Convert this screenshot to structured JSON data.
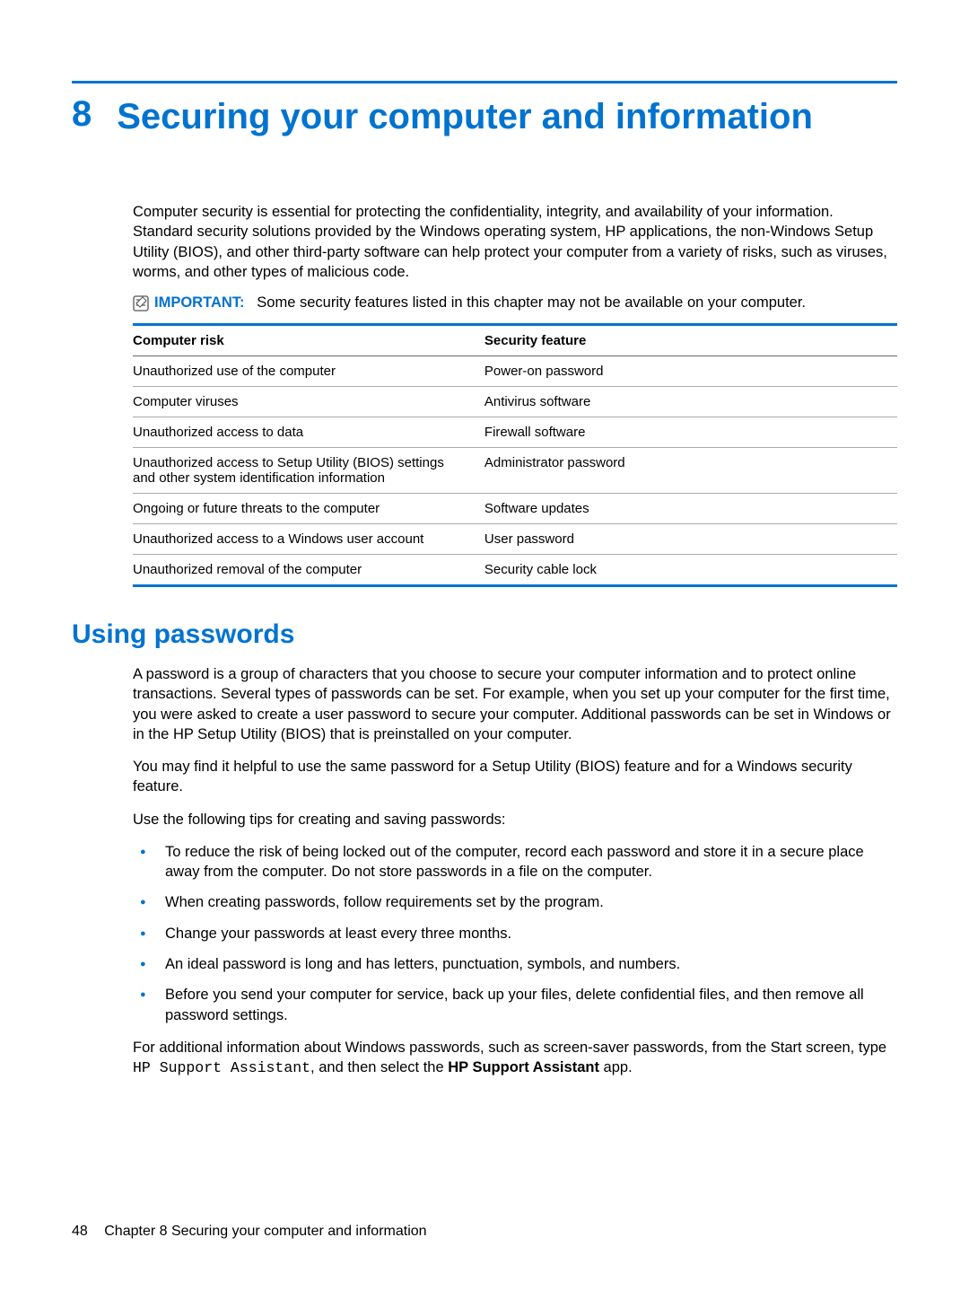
{
  "chapter": {
    "number": "8",
    "title": "Securing your computer and information"
  },
  "intro": "Computer security is essential for protecting the confidentiality, integrity, and availability of your information. Standard security solutions provided by the Windows operating system, HP applications, the non-Windows Setup Utility (BIOS), and other third-party software can help protect your computer from a variety of risks, such as viruses, worms, and other types of malicious code.",
  "important": {
    "label": "IMPORTANT:",
    "text": "Some security features listed in this chapter may not be available on your computer."
  },
  "table": {
    "headers": {
      "risk": "Computer risk",
      "feature": "Security feature"
    },
    "rows": [
      {
        "risk": "Unauthorized use of the computer",
        "feature": "Power-on password"
      },
      {
        "risk": "Computer viruses",
        "feature": "Antivirus software"
      },
      {
        "risk": "Unauthorized access to data",
        "feature": "Firewall software"
      },
      {
        "risk": "Unauthorized access to Setup Utility (BIOS) settings and other system identification information",
        "feature": "Administrator password"
      },
      {
        "risk": "Ongoing or future threats to the computer",
        "feature": "Software updates"
      },
      {
        "risk": "Unauthorized access to a Windows user account",
        "feature": "User password"
      },
      {
        "risk": "Unauthorized removal of the computer",
        "feature": "Security cable lock"
      }
    ]
  },
  "section": {
    "heading": "Using passwords",
    "para1": "A password is a group of characters that you choose to secure your computer information and to protect online transactions. Several types of passwords can be set. For example, when you set up your computer for the first time, you were asked to create a user password to secure your computer. Additional passwords can be set in Windows or in the HP Setup Utility (BIOS) that is preinstalled on your computer.",
    "para2": "You may find it helpful to use the same password for a Setup Utility (BIOS) feature and for a Windows security feature.",
    "para3": "Use the following tips for creating and saving passwords:",
    "tips": [
      "To reduce the risk of being locked out of the computer, record each password and store it in a secure place away from the computer. Do not store passwords in a file on the computer.",
      "When creating passwords, follow requirements set by the program.",
      "Change your passwords at least every three months.",
      "An ideal password is long and has letters, punctuation, symbols, and numbers.",
      "Before you send your computer for service, back up your files, delete confidential files, and then remove all password settings."
    ],
    "para4_pre": "For additional information about Windows passwords, such as screen-saver passwords, from the Start screen, type ",
    "para4_mono": "HP Support Assistant",
    "para4_mid": ", and then select the ",
    "para4_bold": "HP Support Assistant",
    "para4_post": " app."
  },
  "footer": {
    "page": "48",
    "text": "Chapter 8   Securing your computer and information"
  }
}
